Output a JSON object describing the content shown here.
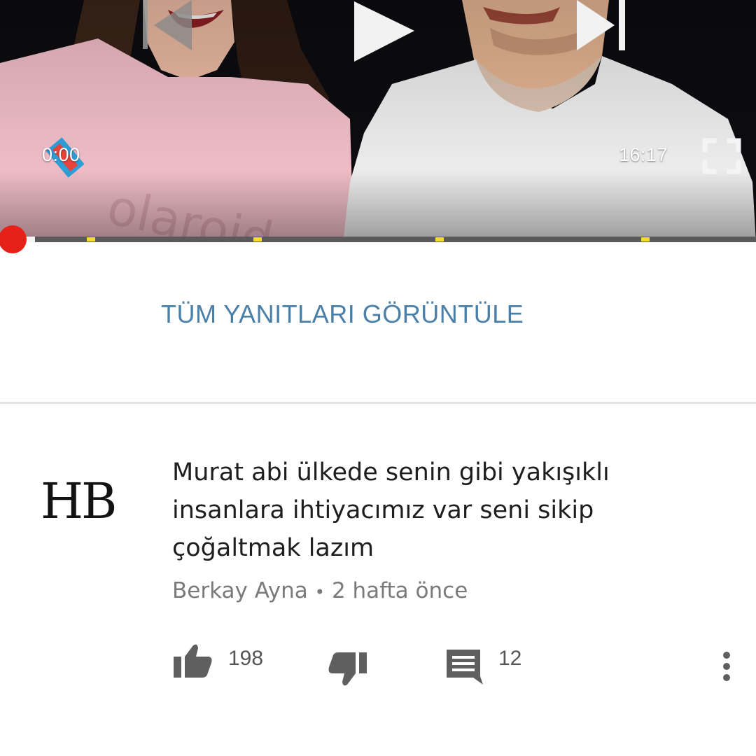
{
  "player": {
    "current_time": "0:00",
    "total_time": "16:17",
    "progress": 0.0,
    "controls": [
      "previous-icon",
      "play-icon",
      "next-icon",
      "fullscreen-icon"
    ],
    "colors": {
      "played": "#e62117",
      "ad_marker": "#f4dd2a",
      "track": "#5a5a5a"
    }
  },
  "replies": {
    "view_all_label": "TÜM YANITLARI GÖRÜNTÜLE",
    "link_color": "#4a80a8"
  },
  "comment": {
    "avatar_text": "HB",
    "text_lines": [
      "Murat abi ülkede senin gibi yakışıklı",
      "insanlara ihtiyacımız var seni sikip",
      "çoğaltmak lazım"
    ],
    "author": "Berkay Ayna",
    "separator": "•",
    "time": "2 hafta önce",
    "like_count": "198",
    "reply_count": "12",
    "icons": [
      "thumb-up-icon",
      "thumb-down-icon",
      "reply-icon",
      "more-vert-icon"
    ]
  }
}
